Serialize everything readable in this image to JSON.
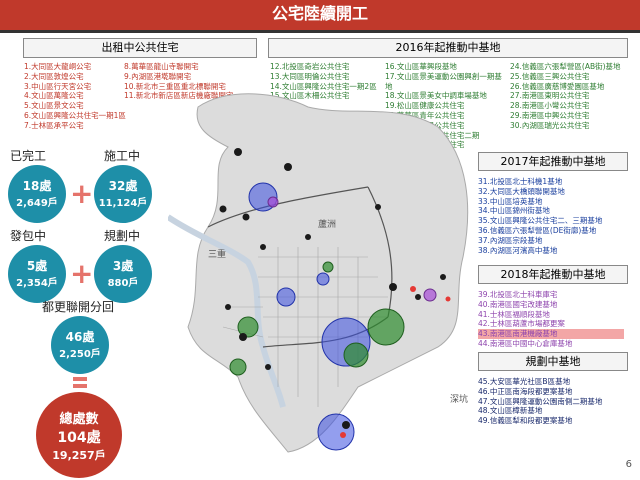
{
  "header": {
    "title": "公宅陸續開工"
  },
  "rent_section": {
    "title": "出租中公共住宅",
    "col1": [
      "1.大同區大龍峒公宅",
      "2.大同區敦煌公宅",
      "3.中山區行天宮公宅",
      "4.文山區萬隆公宅",
      "5.文山區景文公宅",
      "6.文山區興隆公共住宅一期1區",
      "7.士林區承平公宅"
    ],
    "col2": [
      "8.萬華區龍山寺聯開宅",
      "9.內湖區港墘聯開宅",
      "10.新北市三重區重北標聯開宅",
      "11.新北市新店區新店機廠聯開宅"
    ]
  },
  "y2016": {
    "title": "2016年起推動中基地",
    "col1": [
      "12.北投區奇岩公共住宅",
      "13.大同區明倫公共住宅",
      "14.文山區興隆公共住宅一期2區",
      "15.文山區木柵公共住宅"
    ],
    "col2": [
      "16.文山區華興段基地",
      "17.文山區景美運動公園興創一期基地",
      "18.文山區景美女中調車場基地",
      "19.松山區健康公共住宅",
      "20.萬華區青年公共住宅",
      "21.萬華區福星公共住宅",
      "22.萬華區青年公共住宅二期",
      "23.萬華區莒光公共住宅"
    ],
    "col3": [
      "24.信義區六張犁營區(AB街)基地",
      "25.信義區三興公共住宅",
      "26.信義區廣慈博愛園區基地",
      "27.南港區東明公共住宅",
      "28.南港區小彎公共住宅",
      "29.南港區中興公共住宅",
      "30.內湖區瑞光公共住宅"
    ]
  },
  "y2017": {
    "title": "2017年起推動中基地",
    "items": [
      "31.北投區北士科機1基地",
      "32.大同區大橋頭聯開基地",
      "33.中山區培英基地",
      "34.中山區錦州街基地",
      "35.文山區興隆公共住宅二、三期基地",
      "36.信義區六張犁營區(DE街廓)基地",
      "37.內湖區宗段基地",
      "38.內湖區河濱高中基地"
    ]
  },
  "y2018": {
    "title": "2018年起推動中基地",
    "items": [
      "39.北投區北士科車庫宅",
      "40.南港區國宅改建基地",
      "41.士林區福順段基地",
      "42.士林區葫蘆市場都更案",
      "43.南港區南港機廠基地",
      "44.南港區中國中心倉庫基地"
    ]
  },
  "planning": {
    "title": "規劃中基地",
    "items": [
      "45.大安區華光社區B區基地",
      "46.中正區南海段都更案基地",
      "47.文山區興隆運動公園南側二期基地",
      "48.文山區樟新基地",
      "49.信義區犁和段都更案基地"
    ]
  },
  "stats": {
    "done": {
      "label": "已完工",
      "count": "18處",
      "units": "2,649戶"
    },
    "building": {
      "label": "施工中",
      "count": "32處",
      "units": "11,124戶"
    },
    "contract": {
      "label": "發包中",
      "count": "5處",
      "units": "2,354戶"
    },
    "planning": {
      "label": "規劃中",
      "count": "3處",
      "units": "880戶"
    },
    "urban": {
      "label": "都更聯開分回",
      "count": "46處",
      "units": "2,250戶"
    },
    "total": {
      "label": "總處數",
      "count": "104處",
      "units": "19,257戶"
    }
  },
  "map_labels": {
    "luzhou": "蘆洲",
    "sanchong": "三重",
    "shenkeng": "深坑"
  },
  "page_number": "6",
  "colors": {
    "header": "#c0392b",
    "teal": "#1e8fa8",
    "crimson": "#c0392b",
    "plus": "#e5736b"
  }
}
